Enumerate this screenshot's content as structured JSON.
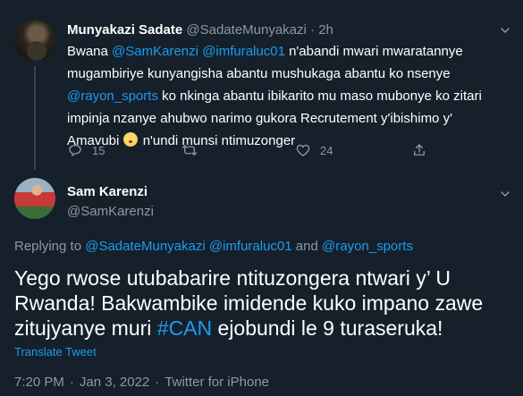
{
  "parent_tweet": {
    "display_name": "Munyakazi Sadate",
    "handle": "@SadateMunyakazi",
    "separator": "·",
    "time": "2h",
    "text": {
      "t1": "Bwana ",
      "mention1": "@SamKarenzi",
      "t2": " ",
      "mention2": "@imfuraluc01",
      "t3": " n'abandi mwari mwaratannye mugambiriye kunyangisha abantu mushukaga abantu ko nsenye ",
      "mention3": "@rayon_sports",
      "t4": " ko nkinga abantu ibikarito mu maso mubonye ko zitari impinja nzanye ahubwo narimo gukora Recrutement y'ibishimo y' Amavubi ",
      "t5": " n'undi munsi ntimuzonger"
    },
    "emoji_icon": "shushing-face-emoji",
    "replies": "15",
    "retweets": "",
    "likes": "24"
  },
  "main_tweet": {
    "display_name": "Sam Karenzi",
    "handle": "@SamKarenzi",
    "replying_to": {
      "prefix": "Replying to ",
      "mention1": "@SadateMunyakazi",
      "space1": " ",
      "mention2": "@imfuraluc01",
      "and": " and ",
      "mention3": "@rayon_sports"
    },
    "text": {
      "t1": "Yego rwose utubabarire ntituzongera ntwari y’ U Rwanda! Bakwambike imidende kuko impano zawe zitujyanye muri ",
      "hashtag": "#CAN",
      "t2": " ejobundi le 9 turaseruka!"
    },
    "translate_label": "Translate Tweet",
    "time": "7:20 PM",
    "dot1": "·",
    "date": "Jan 3, 2022",
    "dot2": "·",
    "source": "Twitter for iPhone"
  },
  "colors": {
    "background": "#15202b",
    "primary_text": "#ffffff",
    "secondary_text": "#8b98a5",
    "link": "#1d9bf0",
    "thread_line": "#38444d"
  },
  "icons": [
    "reply-icon",
    "retweet-icon",
    "like-icon",
    "share-icon",
    "more-caret-icon"
  ]
}
